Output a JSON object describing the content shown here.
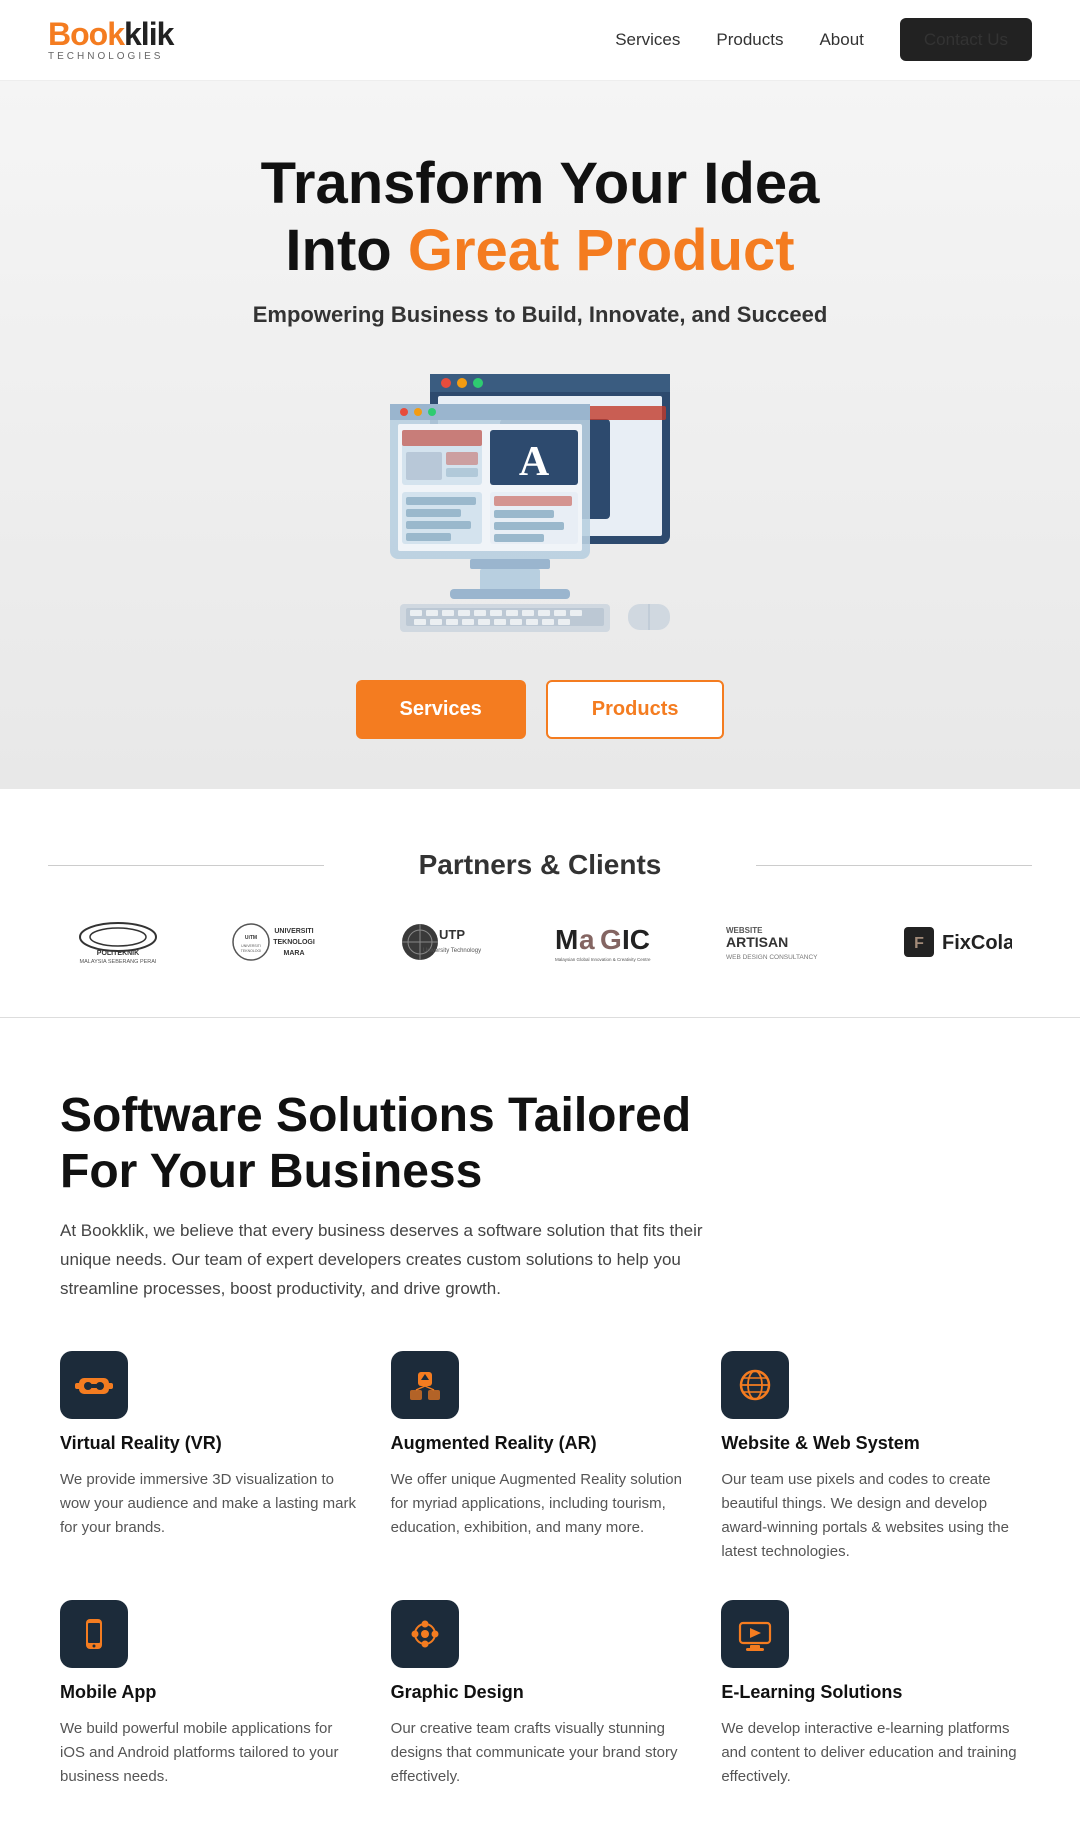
{
  "navbar": {
    "logo_book": "Book",
    "logo_klik": "klik",
    "logo_sub": "TECHNOLOGIES",
    "links": [
      {
        "label": "Services",
        "href": "#"
      },
      {
        "label": "Products",
        "href": "#"
      },
      {
        "label": "About",
        "href": "#"
      }
    ],
    "contact_label": "Contact Us"
  },
  "hero": {
    "headline_line1": "Transform Your Idea",
    "headline_line2_plain": "Into ",
    "headline_line2_orange": "Great Product",
    "subheadline": "Empowering Business to Build, Innovate, and Succeed",
    "btn_services": "Services",
    "btn_products": "Products"
  },
  "partners": {
    "title": "Partners & Clients",
    "logos": [
      {
        "name": "POLITEKNIK MALAYSIA SEBERANG PERAI",
        "short": "POLITEKNIK"
      },
      {
        "name": "UNIVERSITI TEKNOLOGI MARA",
        "short": "UiTM"
      },
      {
        "name": "UTP University Technology Petronas",
        "short": "UTP"
      },
      {
        "name": "Malaysian Global Innovation & Creativity Centre",
        "short": "MaGIC"
      },
      {
        "name": "WEBSITE ARTISAN WEB DESIGN CONSULTANCY",
        "short": "ARTISAN"
      },
      {
        "name": "FixColab",
        "short": "FixColab"
      }
    ]
  },
  "solutions": {
    "heading": "Software Solutions Tailored For Your Business",
    "description": "At Bookklik, we believe that every business deserves a software solution that fits their unique needs. Our team of expert developers creates custom solutions to help you streamline processes, boost productivity, and drive growth.",
    "services": [
      {
        "icon": "vr",
        "name": "Virtual Reality (VR)",
        "desc": "We provide immersive 3D visualization to wow your audience and make a lasting mark for your brands."
      },
      {
        "icon": "ar",
        "name": "Augmented Reality (AR)",
        "desc": "We offer unique Augmented Reality solution for myriad applications, including tourism, education, exhibition, and many more."
      },
      {
        "icon": "web",
        "name": "Website & Web System",
        "desc": "Our team use pixels and codes to create beautiful things. We design and develop award-winning portals & websites using the latest technologies."
      },
      {
        "icon": "mobile",
        "name": "Mobile App",
        "desc": "We build powerful mobile applications for iOS and Android platforms tailored to your business needs."
      },
      {
        "icon": "design",
        "name": "Graphic Design",
        "desc": "Our creative team crafts visually stunning designs that communicate your brand story effectively."
      },
      {
        "icon": "elearning",
        "name": "E-Learning Solutions",
        "desc": "We develop interactive e-learning platforms and content to deliver education and training effectively."
      }
    ]
  }
}
